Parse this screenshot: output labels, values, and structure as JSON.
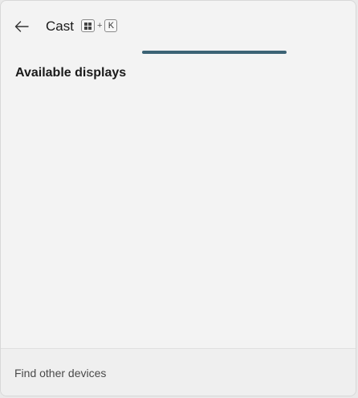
{
  "header": {
    "back_icon": "arrow-left-icon",
    "title": "Cast",
    "shortcut": {
      "key1_icon": "windows-logo-icon",
      "plus": "+",
      "key2": "K"
    }
  },
  "progress": {
    "state": "indeterminate",
    "color": "#3b6274"
  },
  "main": {
    "heading": "Available displays",
    "devices": []
  },
  "footer": {
    "link_label": "Find other devices"
  }
}
